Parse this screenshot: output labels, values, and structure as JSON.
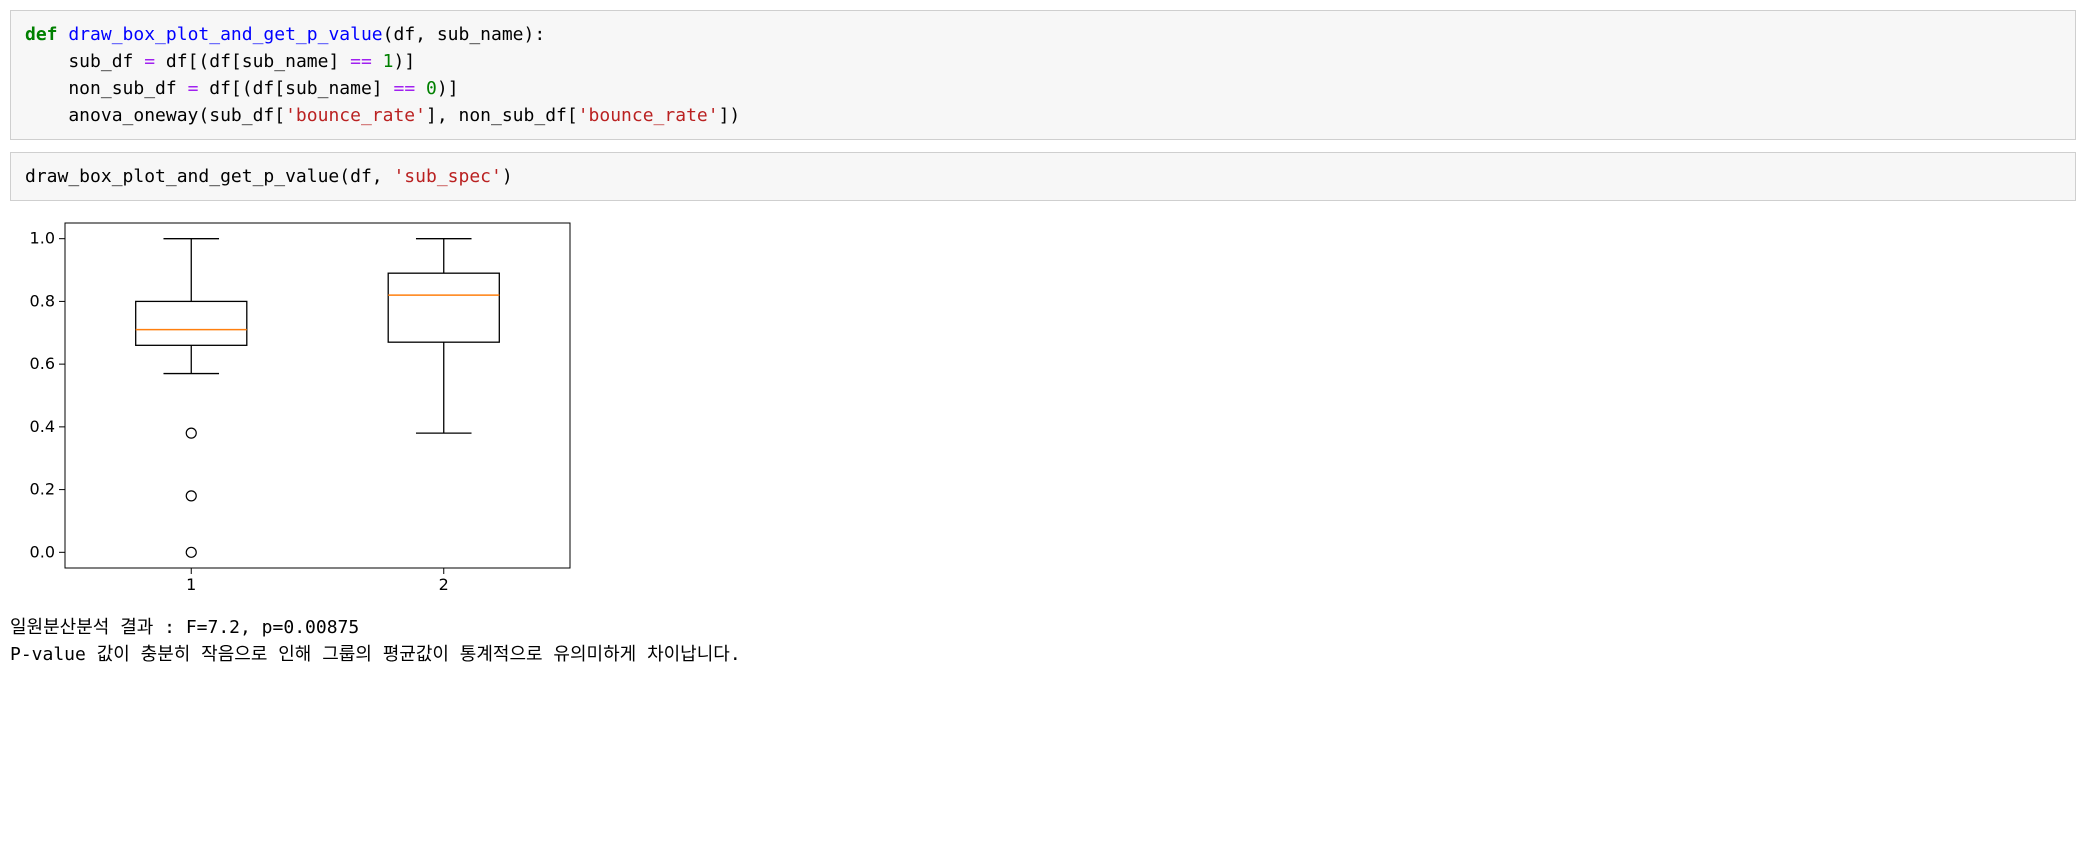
{
  "cell1": {
    "def": "def",
    "fn_name": "draw_box_plot_and_get_p_value",
    "params_open": "(df, sub_name):",
    "line2a": "    sub_df ",
    "eq1": "=",
    "line2b": " df[(df[sub_name] ",
    "eqeq1": "==",
    "sp1": " ",
    "one": "1",
    "line2c": ")]",
    "line3a": "    non_sub_df ",
    "eq2": "=",
    "line3b": " df[(df[sub_name] ",
    "eqeq2": "==",
    "sp2": " ",
    "zero": "0",
    "line3c": ")]",
    "line4a": "    anova_oneway(sub_df[",
    "str1": "'bounce_rate'",
    "line4b": "], non_sub_df[",
    "str2": "'bounce_rate'",
    "line4c": "])"
  },
  "cell2": {
    "call_a": "draw_box_plot_and_get_p_value(df, ",
    "arg_str": "'sub_spec'",
    "call_b": ")"
  },
  "output": {
    "line1": "일원분산분석 결과 : F=7.2, p=0.00875",
    "line2": "P-value 값이 충분히 작음으로 인해 그룹의 평균값이 통계적으로 유의미하게 차이납니다."
  },
  "chart_data": {
    "type": "boxplot",
    "title": "",
    "xlabel": "",
    "ylabel": "",
    "xlim": [
      0.5,
      2.5
    ],
    "ylim": [
      -0.05,
      1.05
    ],
    "y_ticks": [
      0.0,
      0.2,
      0.4,
      0.6,
      0.8,
      1.0
    ],
    "y_tick_labels": [
      "0.0",
      "0.2",
      "0.4",
      "0.6",
      "0.8",
      "1.0"
    ],
    "x_ticks": [
      1,
      2
    ],
    "x_tick_labels": [
      "1",
      "2"
    ],
    "series": [
      {
        "name": "1",
        "q1": 0.66,
        "median": 0.71,
        "q3": 0.8,
        "whisker_low": 0.57,
        "whisker_high": 1.0,
        "outliers": [
          0.38,
          0.18,
          0.0
        ]
      },
      {
        "name": "2",
        "q1": 0.67,
        "median": 0.82,
        "q3": 0.89,
        "whisker_low": 0.38,
        "whisker_high": 1.0,
        "outliers": []
      }
    ],
    "median_color": "#ff7f0e",
    "box_color": "#000000"
  }
}
